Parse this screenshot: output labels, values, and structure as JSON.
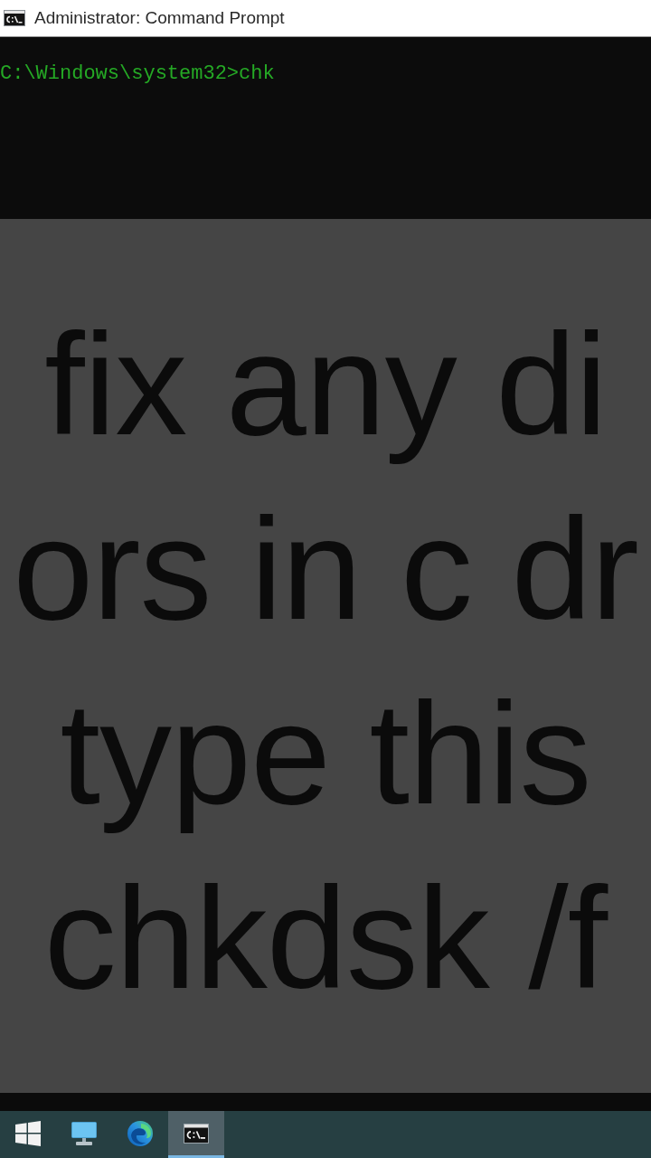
{
  "window": {
    "title": "Administrator: Command Prompt"
  },
  "console": {
    "lines": [
      "C:\\Windows\\system32>chk"
    ]
  },
  "caption": {
    "lines": [
      "fix any di",
      "ors in c dr",
      "type this",
      "chkdsk /f"
    ]
  },
  "taskbar": {
    "items": [
      {
        "kind": "start",
        "selected": false
      },
      {
        "kind": "computer",
        "selected": false
      },
      {
        "kind": "browser",
        "selected": false
      },
      {
        "kind": "terminal",
        "selected": true
      }
    ]
  }
}
